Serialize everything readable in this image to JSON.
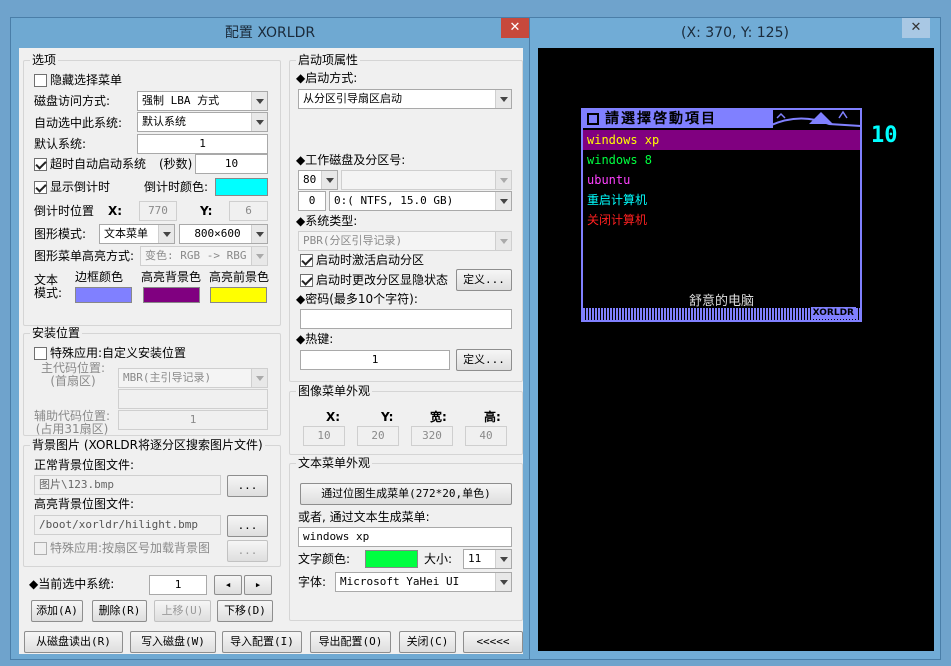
{
  "config_window": {
    "title": "配置 XORLDR",
    "close_glyph": "✕",
    "options": {
      "legend": "选项",
      "hide_menu": {
        "label": "隐藏选择菜单",
        "checked": false
      },
      "disk_access_label": "磁盘访问方式:",
      "disk_access_value": "强制 LBA 方式",
      "auto_select_label": "自动选中此系统:",
      "auto_select_value": "默认系统",
      "default_label": "默认系统:",
      "default_value": "1",
      "timeout": {
        "label": "超时自动启动系统",
        "checked": true,
        "unit_label": "(秒数)",
        "value": "10"
      },
      "show_countdown": {
        "label": "显示倒计时",
        "checked": true
      },
      "countdown_color_label": "倒计时颜色:",
      "countdown_color": "#00ffff",
      "countdown_pos_label": "倒计时位置",
      "x_label": "X:",
      "x_value": "770",
      "y_label": "Y:",
      "y_value": "6",
      "graphics_mode_label": "图形模式:",
      "graphics_mode_value": "文本菜单",
      "resolution_value": "800×600",
      "highlight_mode_label": "图形菜单高亮方式:",
      "highlight_mode_value": "变色: RGB -> RBG",
      "text_mode_label_1": "文本",
      "text_mode_label_2": "模式:",
      "border_color_label": "边框颜色",
      "border_color": "#8080ff",
      "hl_bg_label": "高亮背景色",
      "hl_bg_color": "#800080",
      "hl_fg_label": "高亮前景色",
      "hl_fg_color": "#ffff00"
    },
    "install": {
      "legend": "安装位置",
      "special": {
        "label": "特殊应用:自定义安装位置",
        "checked": false
      },
      "mbr_label_1": "主代码位置:",
      "mbr_label_2": "(首扇区)",
      "mbr_value": "MBR(主引导记录)",
      "aux_label_1": "辅助代码位置:",
      "aux_label_2": "(占用31扇区)",
      "aux_value": "1"
    },
    "background": {
      "legend": "背景图片 (XORLDR将逐分区搜索图片文件)",
      "normal_label": "正常背景位图文件:",
      "normal_value": "图片\\123.bmp",
      "highlight_label": "高亮背景位图文件:",
      "highlight_value": "/boot/xorldr/hilight.bmp",
      "browse_label": "...",
      "special": {
        "label": "特殊应用:按扇区号加载背景图",
        "checked": false
      }
    },
    "current": {
      "label": "◆当前选中系统:",
      "value": "1",
      "prev": "◂",
      "next": "▸"
    },
    "list_buttons": {
      "add": "添加(A)",
      "delete": "删除(R)",
      "up": "上移(U)",
      "down": "下移(D)"
    },
    "bottom_buttons": {
      "read_disk": "从磁盘读出(R)",
      "write_disk": "写入磁盘(W)",
      "import": "导入配置(I)",
      "export": "导出配置(O)",
      "close": "关闭(C)",
      "collapse": "<<<<<"
    },
    "boot_props": {
      "legend": "启动项属性",
      "boot_method_label": "◆启动方式:",
      "boot_method_value": "从分区引导扇区启动",
      "work_disk_label": "◆工作磁盘及分区号:",
      "disk_value": "80",
      "disk_extra_value": "",
      "part_num": "0",
      "part_value": "0:( NTFS,  15.0 GB)",
      "sys_type_label": "◆系统类型:",
      "sys_type_value": "PBR(分区引导记录)",
      "activate": {
        "label": "启动时激活启动分区",
        "checked": true
      },
      "change_visible": {
        "label": "启动时更改分区显隐状态",
        "checked": true
      },
      "define_label": "定义...",
      "password_label": "◆密码(最多10个字符):",
      "password_value": "",
      "hotkey_label": "◆热键:",
      "hotkey_value": "1",
      "hotkey_define_label": "定义..."
    },
    "image_menu": {
      "legend": "图像菜单外观",
      "x_label": "X:",
      "y_label": "Y:",
      "w_label": "宽:",
      "h_label": "高:",
      "x_value": "10",
      "y_value": "20",
      "w_value": "320",
      "h_value": "40"
    },
    "text_menu": {
      "legend": "文本菜单外观",
      "gen_button": "通过位图生成菜单(272*20,单色)",
      "or_label": "或者, 通过文本生成菜单:",
      "text_value": "windows  xp",
      "color_label": "文字颜色:",
      "text_color": "#00ff40",
      "size_label": "大小:",
      "size_value": "11",
      "font_label": "字体:",
      "font_value": "Microsoft YaHei UI"
    }
  },
  "preview_window": {
    "title": "(X: 370, Y: 125)",
    "close_glyph": "✕",
    "menu_title": "請選擇啓動項目",
    "countdown": "10",
    "footer_text": "舒意的电脑",
    "brand": "XORLDR",
    "items": [
      {
        "label": "windows  xp",
        "color": "#ffff00",
        "selected": true
      },
      {
        "label": "windows  8",
        "color": "#00ff40",
        "selected": false
      },
      {
        "label": "ubuntu",
        "color": "#ff40ff",
        "selected": false
      },
      {
        "label": "重启计算机",
        "color": "#00ffff",
        "selected": false
      },
      {
        "label": "关闭计算机",
        "color": "#ff2020",
        "selected": false
      }
    ],
    "highlight_bg": "#800080",
    "border_color": "#8080ff"
  }
}
